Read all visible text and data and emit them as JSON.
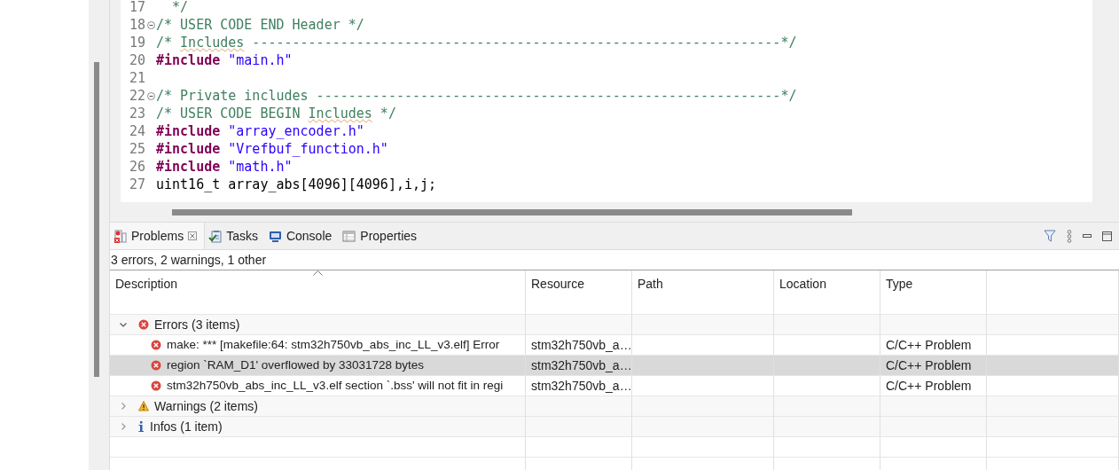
{
  "editor": {
    "lines": [
      {
        "number": "17",
        "fold": false,
        "tokens": [
          {
            "kind": "comment",
            "text": "  */"
          }
        ]
      },
      {
        "number": "18",
        "fold": true,
        "tokens": [
          {
            "kind": "comment",
            "text": "/* USER CODE END Header */"
          }
        ]
      },
      {
        "number": "19",
        "fold": false,
        "tokens": [
          {
            "kind": "comment",
            "text": "/* "
          },
          {
            "kind": "misspelled",
            "text": "Includes"
          },
          {
            "kind": "comment",
            "text": " ------------------------------------------------------------------*/"
          }
        ]
      },
      {
        "number": "20",
        "fold": false,
        "tokens": [
          {
            "kind": "keyword",
            "text": "#include"
          },
          {
            "kind": "string",
            "text": " \"main.h\""
          }
        ]
      },
      {
        "number": "21",
        "fold": false
      },
      {
        "number": "22",
        "fold": true,
        "tokens": [
          {
            "kind": "comment",
            "text": "/* Private includes ----------------------------------------------------------*/"
          }
        ]
      },
      {
        "number": "23",
        "fold": false,
        "tokens": [
          {
            "kind": "comment",
            "text": "/* USER CODE BEGIN "
          },
          {
            "kind": "misspelled",
            "text": "Includes"
          },
          {
            "kind": "comment",
            "text": " */"
          }
        ]
      },
      {
        "number": "24",
        "fold": false,
        "tokens": [
          {
            "kind": "keyword",
            "text": "#include"
          },
          {
            "kind": "string",
            "text": " \"array_encoder.h\""
          }
        ]
      },
      {
        "number": "25",
        "fold": false,
        "tokens": [
          {
            "kind": "keyword",
            "text": "#include"
          },
          {
            "kind": "string",
            "text": " \"Vrefbuf_function.h\""
          }
        ]
      },
      {
        "number": "26",
        "fold": false,
        "tokens": [
          {
            "kind": "keyword",
            "text": "#include"
          },
          {
            "kind": "string",
            "text": " \"math.h\""
          }
        ]
      },
      {
        "number": "27",
        "fold": false,
        "tokens": [
          {
            "kind": "plain",
            "text": "uint16_t array_abs[4096][4096],i,j;"
          }
        ]
      }
    ]
  },
  "panel": {
    "tabs": [
      {
        "label": "Problems",
        "selected": true,
        "closable": true
      },
      {
        "label": "Tasks",
        "selected": false,
        "closable": false
      },
      {
        "label": "Console",
        "selected": false,
        "closable": false
      },
      {
        "label": "Properties",
        "selected": false,
        "closable": false
      }
    ],
    "summary": "3 errors, 2 warnings, 1 other",
    "columns": [
      "Description",
      "Resource",
      "Path",
      "Location",
      "Type"
    ],
    "groups": [
      {
        "label": "Errors (3 items)",
        "kind": "error",
        "expanded": true,
        "children": [
          {
            "description": "make: *** [makefile:64: stm32h750vb_abs_inc_LL_v3.elf] Error",
            "resource": "stm32h750vb_a…",
            "type": "C/C++ Problem",
            "selected": false
          },
          {
            "description": "region `RAM_D1' overflowed by 33031728 bytes",
            "resource": "stm32h750vb_a…",
            "type": "C/C++ Problem",
            "selected": true
          },
          {
            "description": "stm32h750vb_abs_inc_LL_v3.elf section `.bss' will not fit in regi",
            "resource": "stm32h750vb_a…",
            "type": "C/C++ Problem",
            "selected": false
          }
        ]
      },
      {
        "label": "Warnings (2 items)",
        "kind": "warning",
        "expanded": false
      },
      {
        "label": "Infos (1 item)",
        "kind": "info",
        "expanded": false
      }
    ]
  }
}
